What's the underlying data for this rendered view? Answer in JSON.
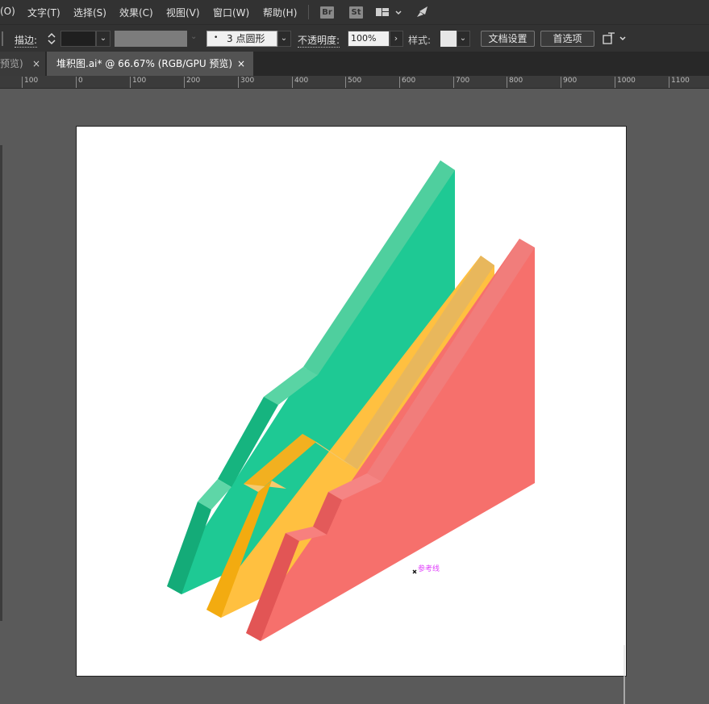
{
  "menubar": {
    "items": [
      "(O)",
      "文字(T)",
      "选择(S)",
      "效果(C)",
      "视图(V)",
      "窗口(W)",
      "帮助(H)"
    ],
    "bridge_label": "Br",
    "stock_label": "St"
  },
  "controlbar": {
    "stroke_label": "描边",
    "brush_value": "3 点圆形",
    "opacity_label": "不透明度",
    "opacity_value": "100%",
    "style_label": "样式",
    "doc_setup_label": "文档设置",
    "prefs_label": "首选项"
  },
  "tabs": [
    {
      "label": "预览)",
      "close": "×"
    },
    {
      "label": "堆积图.ai* @ 66.67% (RGB/GPU 预览)",
      "close": "×"
    }
  ],
  "ruler": {
    "labels": [
      "100",
      "0",
      "100",
      "200",
      "300",
      "400",
      "500",
      "600",
      "700",
      "800",
      "900",
      "1000",
      "1100"
    ]
  },
  "canvas": {
    "guide_label": "参考线",
    "colors": {
      "green": "#1ec994",
      "yellow": "#ffc040",
      "red": "#f6706c"
    }
  }
}
